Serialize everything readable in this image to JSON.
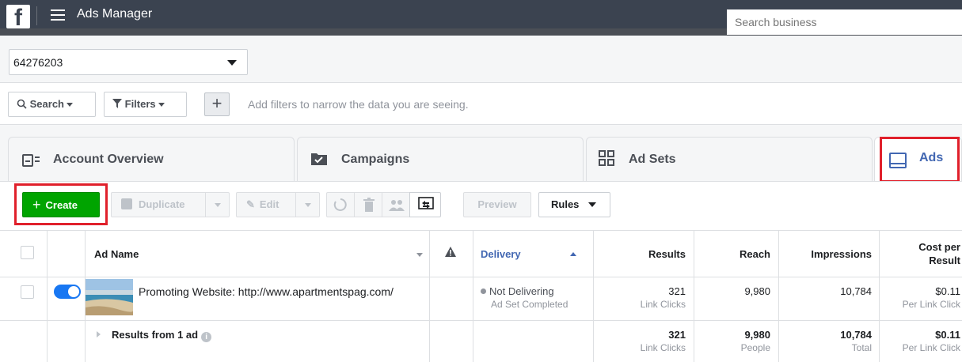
{
  "header": {
    "logo_letter": "f",
    "title": "Ads Manager",
    "search_placeholder": "Search business"
  },
  "account": {
    "selected": "64276203"
  },
  "filters": {
    "search_label": "Search",
    "filters_label": "Filters",
    "plus": "+",
    "hint": "Add filters to narrow the data you are seeing."
  },
  "tabs": [
    {
      "label": "Account Overview",
      "icon": "account-overview-icon"
    },
    {
      "label": "Campaigns",
      "icon": "folder-check-icon"
    },
    {
      "label": "Ad Sets",
      "icon": "grid-icon"
    },
    {
      "label": "Ads",
      "icon": "ad-icon",
      "active": true
    }
  ],
  "toolbar": {
    "create_label": "Create",
    "duplicate_label": "Duplicate",
    "edit_label": "Edit",
    "preview_label": "Preview",
    "rules_label": "Rules"
  },
  "table": {
    "headers": {
      "ad_name": "Ad Name",
      "delivery": "Delivery",
      "results": "Results",
      "reach": "Reach",
      "impressions": "Impressions",
      "cost_line1": "Cost per",
      "cost_line2": "Result"
    },
    "row": {
      "name": "Promoting Website: http://www.apartmentspag.com/",
      "delivery": "Not Delivering",
      "delivery_sub": "Ad Set Completed",
      "results": "321",
      "results_sub": "Link Clicks",
      "reach": "9,980",
      "impressions": "10,784",
      "cost": "$0.11",
      "cost_sub": "Per Link Click"
    },
    "summary": {
      "label": "Results from 1 ad",
      "info": "i",
      "results": "321",
      "results_sub": "Link Clicks",
      "reach": "9,980",
      "reach_sub": "People",
      "impressions": "10,784",
      "impressions_sub": "Total",
      "cost": "$0.11",
      "cost_sub": "Per Link Click"
    }
  },
  "colors": {
    "topbar": "#3b4350",
    "create": "#00a400",
    "highlight": "#e0202b",
    "active_tab": "#4267b2",
    "toggle": "#1877f2"
  }
}
